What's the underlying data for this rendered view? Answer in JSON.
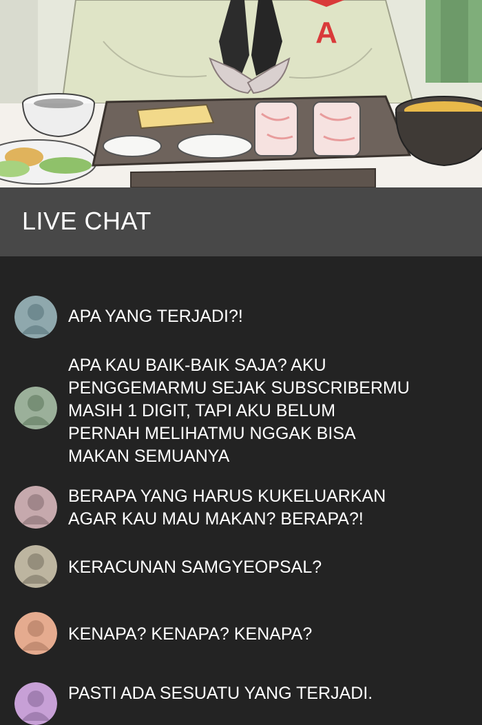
{
  "header": {
    "title": "LIVE CHAT"
  },
  "scene": {
    "emblem_text": "A"
  },
  "messages": [
    {
      "text": "APA YANG TERJADI?!",
      "avatar_icon": "user-silhouette-icon",
      "avatar_bg": "#8fa8ad",
      "avatar_fg": "#6f8a90"
    },
    {
      "text": "APA KAU BAIK-BAIK SAJA? AKU\nPENGGEMARMU SEJAK SUBSCRIBERMU\nMASIH 1 DIGIT, TAPI AKU BELUM\nPERNAH MELIHATMU NGGAK BISA\nMAKAN SEMUANYA",
      "avatar_icon": "user-silhouette-icon",
      "avatar_bg": "#9bb09a",
      "avatar_fg": "#778f76"
    },
    {
      "text": "BERAPA YANG HARUS KUKELUARKAN\nAGAR KAU MAU MAKAN? BERAPA?!",
      "avatar_icon": "user-silhouette-icon",
      "avatar_bg": "#c6a9ad",
      "avatar_fg": "#a0868a"
    },
    {
      "text": "KERACUNAN SAMGYEOPSAL?",
      "avatar_icon": "user-silhouette-icon",
      "avatar_bg": "#bdb5a0",
      "avatar_fg": "#958e7c"
    },
    {
      "text": "KENAPA? KENAPA? KENAPA?",
      "avatar_icon": "user-silhouette-icon",
      "avatar_bg": "#e5ab8f",
      "avatar_fg": "#c48d73"
    },
    {
      "text": "PASTI ADA SESUATU YANG TERJADI.",
      "avatar_icon": "user-silhouette-icon",
      "avatar_bg": "#c7a0d6",
      "avatar_fg": "#a27fb2"
    }
  ]
}
